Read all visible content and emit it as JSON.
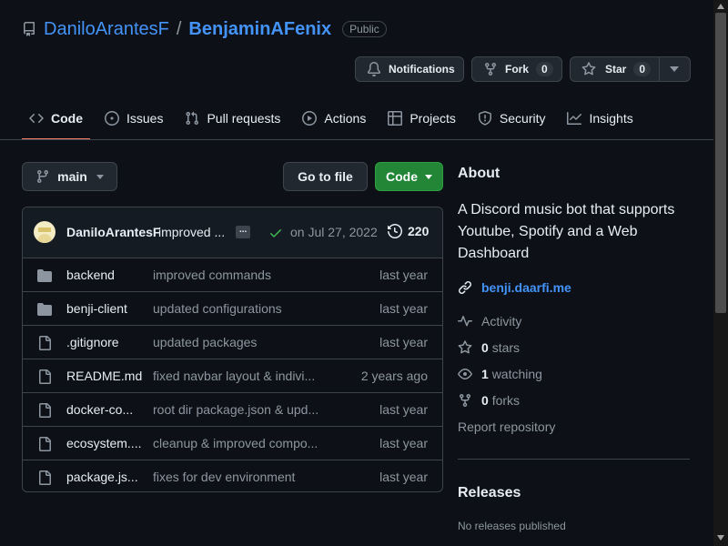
{
  "repo": {
    "owner": "DaniloArantesF",
    "separator": "/",
    "name": "BenjaminAFenix",
    "visibility": "Public"
  },
  "header_actions": {
    "notifications_label": "Notifications",
    "fork_label": "Fork",
    "fork_count": "0",
    "star_label": "Star",
    "star_count": "0"
  },
  "tabs": [
    {
      "label": "Code",
      "icon": "code-icon",
      "active": true
    },
    {
      "label": "Issues",
      "icon": "issue-icon"
    },
    {
      "label": "Pull requests",
      "icon": "pull-request-icon"
    },
    {
      "label": "Actions",
      "icon": "play-icon"
    },
    {
      "label": "Projects",
      "icon": "table-icon"
    },
    {
      "label": "Security",
      "icon": "shield-icon"
    },
    {
      "label": "Insights",
      "icon": "graph-icon"
    }
  ],
  "toolbar": {
    "branch": "main",
    "go_to_file": "Go to file",
    "code_button": "Code"
  },
  "commit": {
    "author": "DaniloArantesF",
    "message": "improved ...",
    "ellipsis": "...",
    "date": "on Jul 27, 2022",
    "commit_count": "220"
  },
  "files": [
    {
      "type": "folder",
      "name": "backend",
      "message": "improved commands",
      "date": "last year"
    },
    {
      "type": "folder",
      "name": "benji-client",
      "message": "updated configurations",
      "date": "last year"
    },
    {
      "type": "file",
      "name": ".gitignore",
      "message": "updated packages",
      "date": "last year"
    },
    {
      "type": "file",
      "name": "README.md",
      "message": "fixed navbar layout & indivi...",
      "date": "2 years ago"
    },
    {
      "type": "file",
      "name": "docker-co...",
      "message": "root dir package.json & upd...",
      "date": "last year"
    },
    {
      "type": "file",
      "name": "ecosystem....",
      "message": "cleanup & improved compo...",
      "date": "last year"
    },
    {
      "type": "file",
      "name": "package.js...",
      "message": "fixes for dev environment",
      "date": "last year"
    }
  ],
  "about": {
    "title": "About",
    "description": "A Discord music bot that supports Youtube, Spotify and a Web Dashboard",
    "website": "benji.daarfi.me",
    "activity": "Activity",
    "stars_count": "0",
    "stars_label": "stars",
    "watching_count": "1",
    "watching_label": "watching",
    "forks_count": "0",
    "forks_label": "forks",
    "report": "Report repository"
  },
  "releases": {
    "title": "Releases",
    "empty": "No releases published"
  },
  "colors": {
    "background": "#0d1117",
    "link": "#4493f8",
    "accent_underline": "#f78166",
    "code_button": "#238636",
    "success": "#3fb950"
  }
}
